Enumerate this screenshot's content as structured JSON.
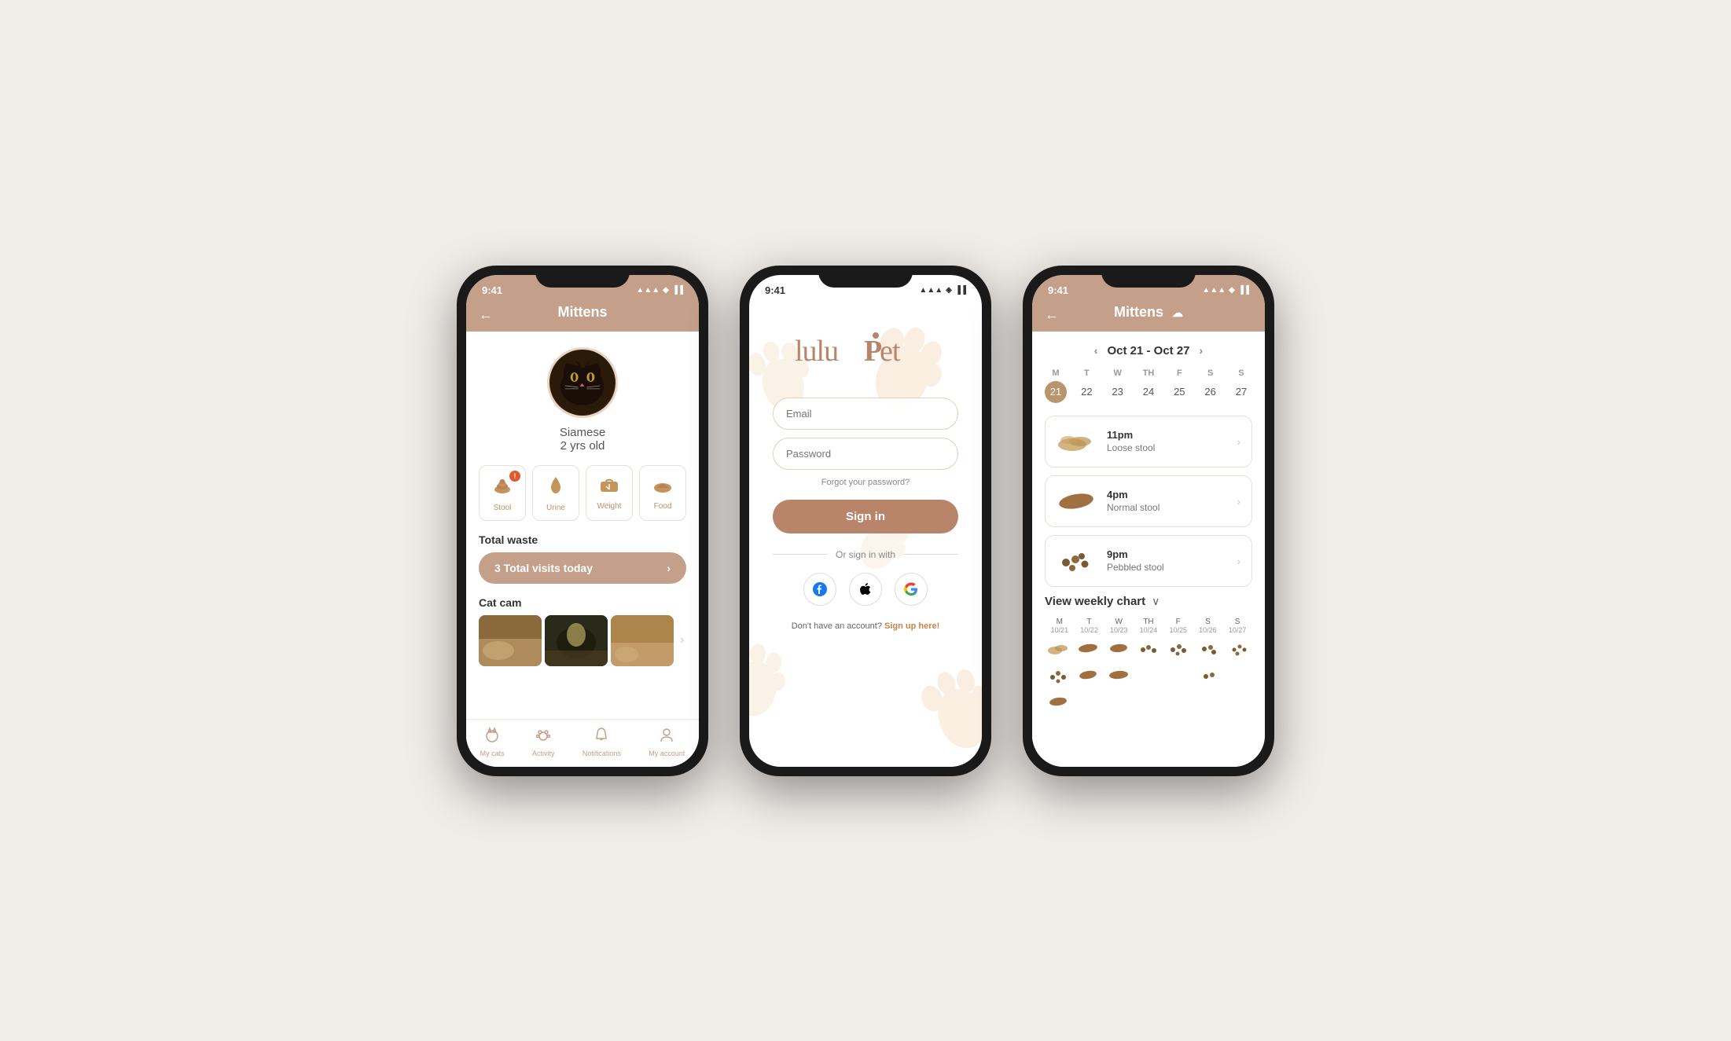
{
  "phone1": {
    "statusBar": {
      "time": "9:41",
      "icons": "▲ ◈ ▐▐"
    },
    "header": {
      "title": "Mittens",
      "backLabel": "←"
    },
    "pet": {
      "breed": "Siamese",
      "age": "2 yrs old"
    },
    "stats": [
      {
        "id": "stool",
        "icon": "💩",
        "label": "Stool",
        "badge": "!"
      },
      {
        "id": "urine",
        "icon": "💧",
        "label": "Urine",
        "badge": ""
      },
      {
        "id": "weight",
        "icon": "⚖️",
        "label": "Weight",
        "badge": ""
      },
      {
        "id": "food",
        "icon": "🍚",
        "label": "Food",
        "badge": ""
      }
    ],
    "totalWaste": {
      "sectionTitle": "Total waste",
      "buttonText": "3  Total visits today",
      "arrow": "›"
    },
    "catCam": {
      "sectionTitle": "Cat cam"
    },
    "bottomNav": [
      {
        "id": "my-cats",
        "label": "My cats",
        "icon": "🐱",
        "active": true
      },
      {
        "id": "activity",
        "label": "Activity",
        "icon": "🐾",
        "active": false
      },
      {
        "id": "notifications",
        "label": "Notifications",
        "icon": "🔔",
        "active": false
      },
      {
        "id": "account",
        "label": "My account",
        "icon": "👤",
        "active": false
      }
    ]
  },
  "phone2": {
    "statusBar": {
      "time": "9:41"
    },
    "logo": "luluPet",
    "emailPlaceholder": "Email",
    "passwordPlaceholder": "Password",
    "forgotPassword": "Forgot your password?",
    "signInButton": "Sign in",
    "orSignInWith": "Or sign in with",
    "socialButtons": [
      "f",
      "",
      "G"
    ],
    "noAccount": "Don't have an account?",
    "signUpLink": "Sign up here!"
  },
  "phone3": {
    "statusBar": {
      "time": "9:41"
    },
    "header": {
      "title": "Mittens",
      "backLabel": "←",
      "cloudIcon": "☁"
    },
    "weekNav": {
      "prevArrow": "‹",
      "dateRange": "Oct 21 - Oct 27",
      "nextArrow": "›"
    },
    "days": [
      {
        "letter": "M",
        "num": "21",
        "active": true
      },
      {
        "letter": "T",
        "num": "22",
        "active": false
      },
      {
        "letter": "W",
        "num": "23",
        "active": false
      },
      {
        "letter": "TH",
        "num": "24",
        "active": false
      },
      {
        "letter": "F",
        "num": "25",
        "active": false
      },
      {
        "letter": "S",
        "num": "26",
        "active": false
      },
      {
        "letter": "S",
        "num": "27",
        "active": false
      }
    ],
    "entries": [
      {
        "time": "11pm",
        "type": "Loose stool",
        "stoolType": "loose"
      },
      {
        "time": "4pm",
        "type": "Normal stool",
        "stoolType": "normal"
      },
      {
        "time": "9pm",
        "type": "Pebbled stool",
        "stoolType": "pebble"
      }
    ],
    "weeklyChart": {
      "title": "View weekly chart",
      "toggle": "∨",
      "days": [
        "M",
        "T",
        "W",
        "TH",
        "F",
        "S",
        "S"
      ],
      "dates": [
        "10/21",
        "10/22",
        "10/23",
        "10/24",
        "10/25",
        "10/26",
        "10/27"
      ]
    }
  },
  "colors": {
    "primaryBrown": "#c4a08a",
    "accentBrown": "#b8856a",
    "lightBrown": "#e8d5c4",
    "darkText": "#333333",
    "lightText": "#888888",
    "white": "#ffffff",
    "badge": "#e05a2b"
  }
}
